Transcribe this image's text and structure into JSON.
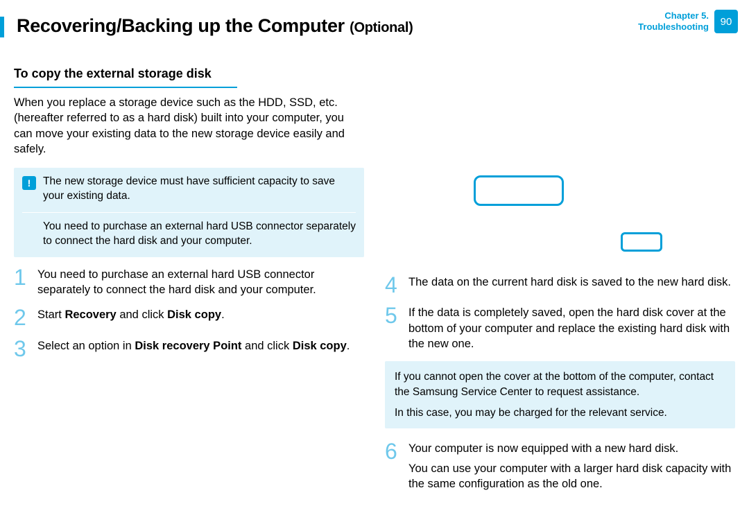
{
  "header": {
    "title": "Recovering/Backing up the Computer",
    "optional": "(Optional)",
    "chapter_label": "Chapter 5.",
    "chapter_name": "Troubleshooting",
    "page_number": "90"
  },
  "left": {
    "subhead": "To copy the external storage disk",
    "intro": "When you replace a storage device such as the HDD, SSD, etc. (hereafter referred to as a hard disk) built into your computer, you can move your existing data to the new storage device easily and safely.",
    "note1": "The new storage device must have sufficient capacity to save your existing data.",
    "note2": "You need to purchase an external hard USB connector separately to connect the hard disk and your computer.",
    "step1": "You need to purchase an external hard USB connector separately to connect the hard disk and your computer.",
    "step2_pre": "Start ",
    "step2_b1": "Recovery",
    "step2_mid": " and click ",
    "step2_b2": "Disk copy",
    "step2_suf": ".",
    "step3_pre": "Select an option in ",
    "step3_b1": "Disk recovery Point",
    "step3_mid": " and click ",
    "step3_b2": "Disk copy",
    "step3_suf": "."
  },
  "right": {
    "step4": "The data on the current hard disk is saved to the new hard disk.",
    "step5": "If the data is completely saved, open the hard disk cover at the bottom of your computer and replace the existing hard disk with the new one.",
    "info_p1": "If you cannot open the cover at the bottom of the computer, contact the Samsung Service Center to request assistance.",
    "info_p2": "In this case, you may be charged for the relevant service.",
    "step6_p1": "Your computer is now equipped with a new hard disk.",
    "step6_p2": "You can use your computer with a larger hard disk capacity with the same configuration as the old one."
  },
  "nums": {
    "n1": "1",
    "n2": "2",
    "n3": "3",
    "n4": "4",
    "n5": "5",
    "n6": "6"
  }
}
